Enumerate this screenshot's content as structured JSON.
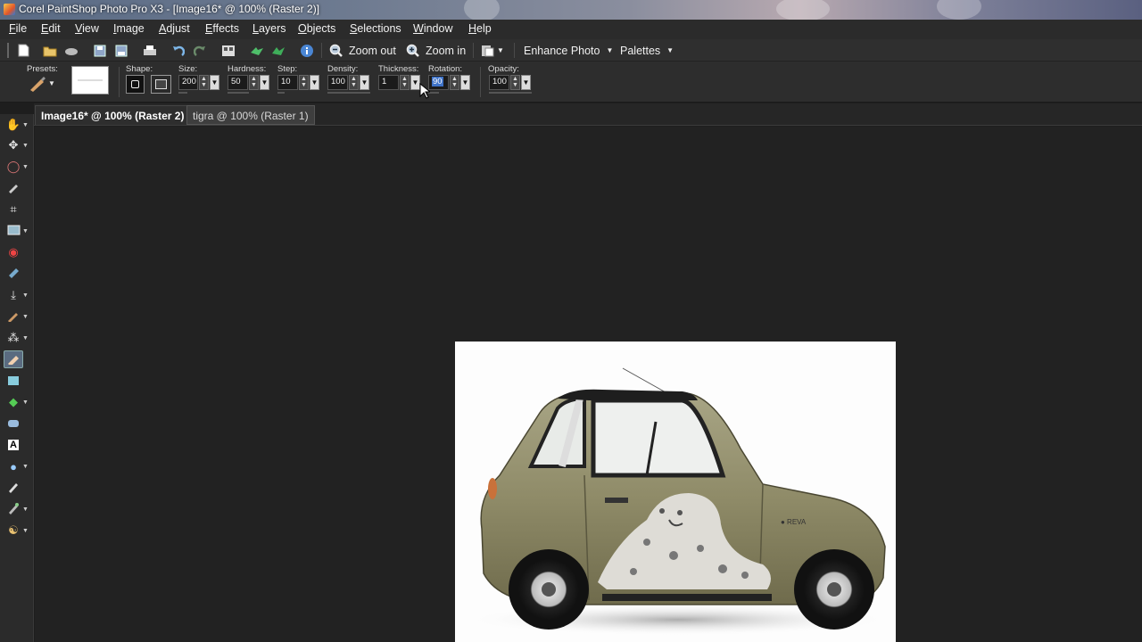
{
  "window": {
    "title": "Corel PaintShop Photo Pro X3 - [Image16* @ 100% (Raster 2)]"
  },
  "menu": [
    "File",
    "Edit",
    "View",
    "Image",
    "Adjust",
    "Effects",
    "Layers",
    "Objects",
    "Selections",
    "Window",
    "Help"
  ],
  "toolbar": {
    "zoom_out_label": "Zoom out",
    "zoom_in_label": "Zoom in",
    "enhance_photo_label": "Enhance Photo",
    "palettes_label": "Palettes",
    "icons": [
      "new-icon",
      "open-icon",
      "scan-icon",
      "save-icon",
      "save-as-icon",
      "print-icon",
      "undo-icon",
      "redo-icon",
      "browse-icon",
      "forward-icon",
      "share-icon",
      "info-icon"
    ]
  },
  "options": {
    "presets_label": "Presets:",
    "shape_label": "Shape:",
    "size_label": "Size:",
    "size_value": "200",
    "hardness_label": "Hardness:",
    "hardness_value": "50",
    "step_label": "Step:",
    "step_value": "10",
    "density_label": "Density:",
    "density_value": "100",
    "thickness_label": "Thickness:",
    "thickness_value": "1",
    "rotation_label": "Rotation:",
    "rotation_value": "90",
    "opacity_label": "Opacity:",
    "opacity_value": "100"
  },
  "tabs": [
    {
      "label": "Image16* @ 100% (Raster 2)",
      "active": true
    },
    {
      "label": "tigra @ 100% (Raster 1)",
      "active": false
    }
  ],
  "tools": [
    "pan-icon",
    "move-icon",
    "lasso-icon",
    "dropper-icon",
    "crop-icon",
    "straighten-icon",
    "red-eye-icon",
    "makeover-icon",
    "clone-icon",
    "paint-brush-icon",
    "dodge-icon",
    "eraser-brush-icon",
    "retouch-icon",
    "fill-icon",
    "background-eraser-icon",
    "text-icon",
    "shape-icon",
    "pen-icon",
    "picture-tube-icon",
    "warp-icon"
  ],
  "colors": {
    "accent": "#5a6b80",
    "workspace": "#222222",
    "menubar": "#2b2b2b"
  }
}
